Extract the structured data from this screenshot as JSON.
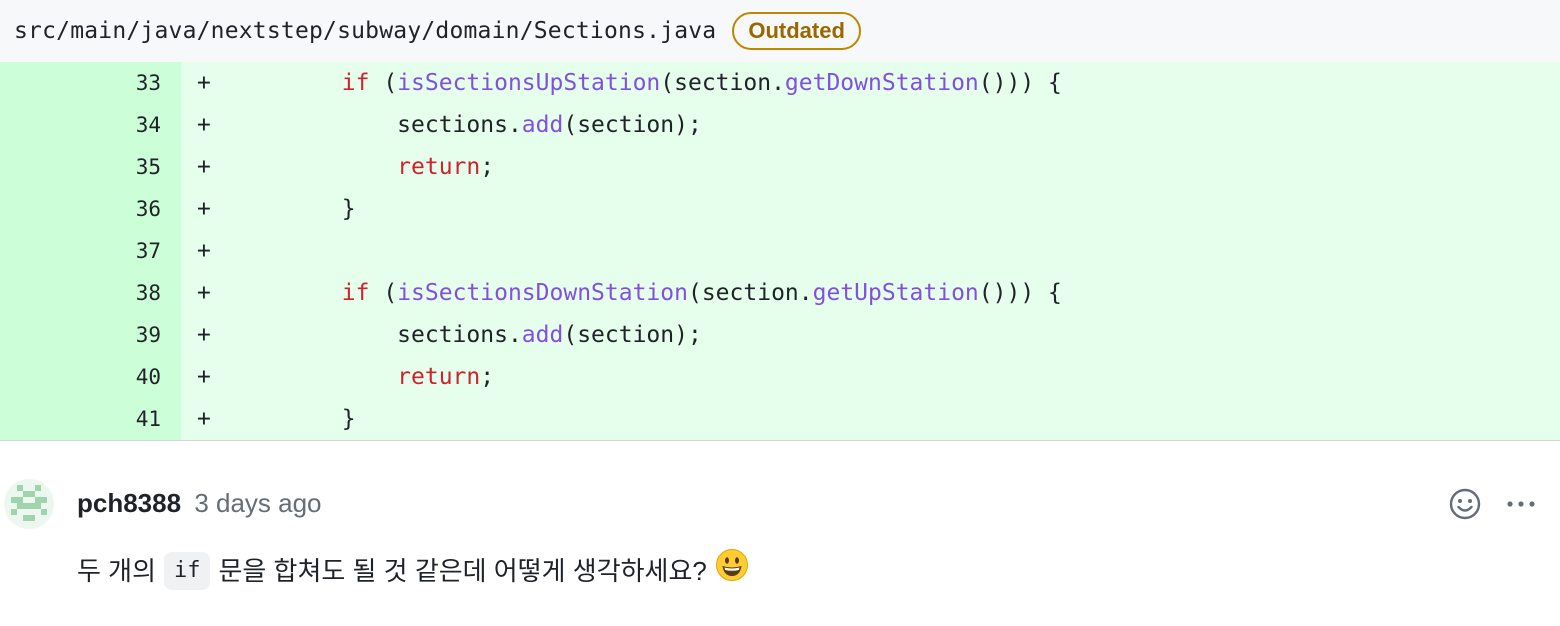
{
  "file": {
    "path": "src/main/java/nextstep/subway/domain/Sections.java",
    "badge": "Outdated"
  },
  "diff_lines": [
    {
      "number": "33",
      "marker": "+",
      "indent": "        ",
      "tokens": [
        {
          "t": "kw",
          "v": "if"
        },
        {
          "t": "p",
          "v": " ("
        },
        {
          "t": "fn",
          "v": "isSectionsUpStation"
        },
        {
          "t": "p",
          "v": "(section."
        },
        {
          "t": "fn",
          "v": "getDownStation"
        },
        {
          "t": "p",
          "v": "())) {"
        }
      ]
    },
    {
      "number": "34",
      "marker": "+",
      "indent": "            ",
      "tokens": [
        {
          "t": "p",
          "v": "sections."
        },
        {
          "t": "fn",
          "v": "add"
        },
        {
          "t": "p",
          "v": "(section);"
        }
      ]
    },
    {
      "number": "35",
      "marker": "+",
      "indent": "            ",
      "tokens": [
        {
          "t": "kw",
          "v": "return"
        },
        {
          "t": "p",
          "v": ";"
        }
      ]
    },
    {
      "number": "36",
      "marker": "+",
      "indent": "        ",
      "tokens": [
        {
          "t": "p",
          "v": "}"
        }
      ]
    },
    {
      "number": "37",
      "marker": "+",
      "indent": "",
      "tokens": []
    },
    {
      "number": "38",
      "marker": "+",
      "indent": "        ",
      "tokens": [
        {
          "t": "kw",
          "v": "if"
        },
        {
          "t": "p",
          "v": " ("
        },
        {
          "t": "fn",
          "v": "isSectionsDownStation"
        },
        {
          "t": "p",
          "v": "(section."
        },
        {
          "t": "fn",
          "v": "getUpStation"
        },
        {
          "t": "p",
          "v": "())) {"
        }
      ]
    },
    {
      "number": "39",
      "marker": "+",
      "indent": "            ",
      "tokens": [
        {
          "t": "p",
          "v": "sections."
        },
        {
          "t": "fn",
          "v": "add"
        },
        {
          "t": "p",
          "v": "(section);"
        }
      ]
    },
    {
      "number": "40",
      "marker": "+",
      "indent": "            ",
      "tokens": [
        {
          "t": "kw",
          "v": "return"
        },
        {
          "t": "p",
          "v": ";"
        }
      ]
    },
    {
      "number": "41",
      "marker": "+",
      "indent": "        ",
      "tokens": [
        {
          "t": "p",
          "v": "}"
        }
      ]
    }
  ],
  "comment": {
    "author": "pch8388",
    "time": "3 days ago",
    "body_before": "두 개의",
    "body_code": "if",
    "body_after": "문을 합쳐도 될 것 같은데 어떻게 생각하세요?",
    "emoji": "grinning-face-emoji",
    "actions": {
      "reaction_icon": "smiley-icon",
      "more_icon": "kebab-horizontal-icon"
    }
  },
  "colors": {
    "line_number_bg": "#ccffd8",
    "code_bg": "#e6ffec",
    "keyword": "#cf222e",
    "function": "#8250df",
    "badge": "#9a6700"
  }
}
